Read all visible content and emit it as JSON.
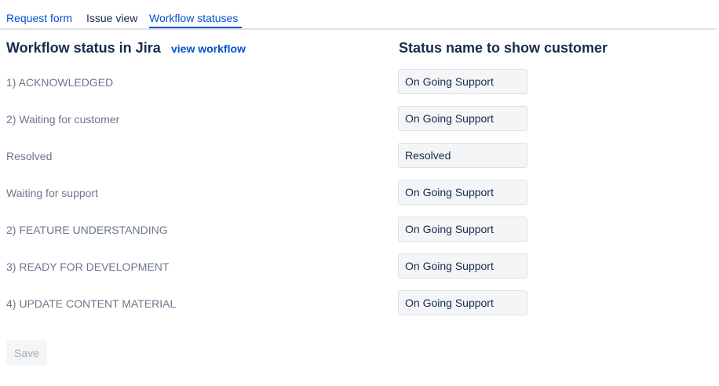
{
  "tabs": [
    {
      "label": "Request form"
    },
    {
      "label": "Issue view"
    },
    {
      "label": "Workflow statuses"
    }
  ],
  "header": {
    "left_title": "Workflow status in Jira",
    "view_workflow_link": "view workflow",
    "right_title": "Status name to show customer"
  },
  "rows": [
    {
      "jira_status": "1) ACKNOWLEDGED",
      "customer_status": "On Going Support"
    },
    {
      "jira_status": "2) Waiting for customer",
      "customer_status": "On Going Support"
    },
    {
      "jira_status": "Resolved",
      "customer_status": "Resolved"
    },
    {
      "jira_status": "Waiting for support",
      "customer_status": "On Going Support"
    },
    {
      "jira_status": "2) FEATURE UNDERSTANDING",
      "customer_status": "On Going Support"
    },
    {
      "jira_status": "3) READY FOR DEVELOPMENT",
      "customer_status": "On Going Support"
    },
    {
      "jira_status": "4) UPDATE CONTENT MATERIAL",
      "customer_status": "On Going Support"
    }
  ],
  "footer": {
    "save_label": "Save"
  },
  "colors": {
    "accent": "#0052cc",
    "text": "#172b4d",
    "muted": "#6b778c",
    "field_bg": "#f4f5f7"
  }
}
